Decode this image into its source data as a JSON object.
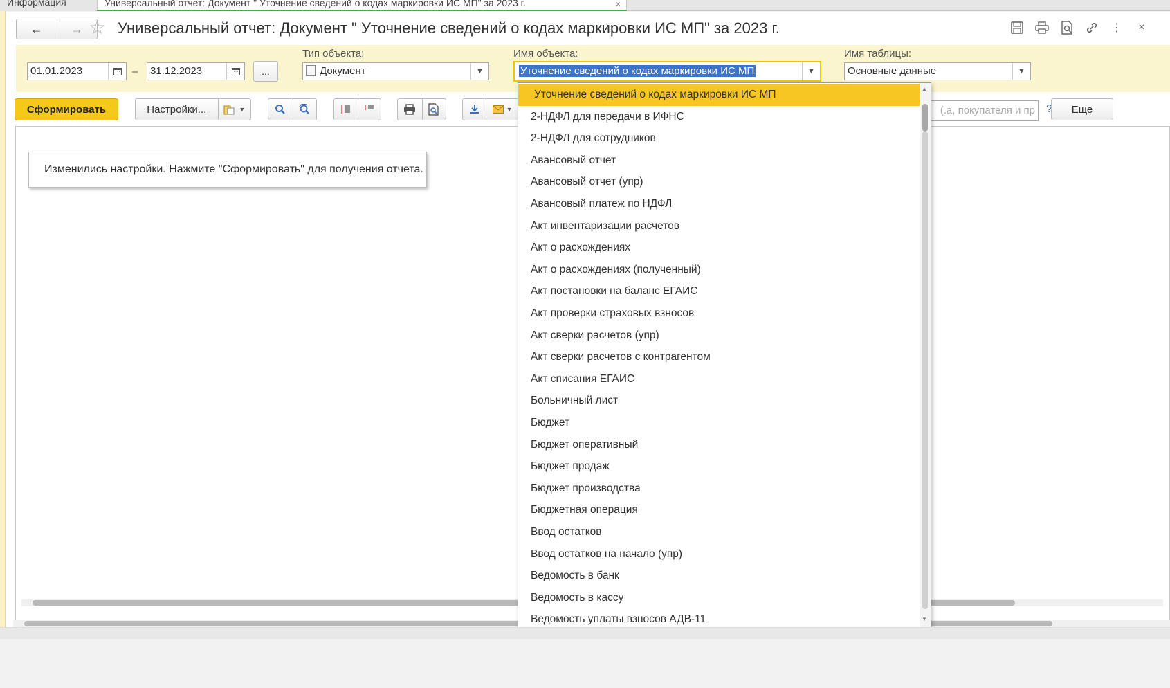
{
  "tabs": [
    {
      "label": "Информация"
    },
    {
      "label": "Универсальный отчет: Документ \" Уточнение сведений о кодах маркировки ИС МП\" за 2023 г."
    }
  ],
  "title": "Универсальный отчет: Документ \" Уточнение сведений о кодах маркировки ИС МП\" за 2023 г.",
  "icons": {
    "back": "←",
    "forward": "→",
    "star": "☆",
    "save": "🖫",
    "print": "⎙",
    "preview": "🔍",
    "link": "🔗",
    "more": "⋮",
    "close": "×"
  },
  "filters": {
    "date_from": "01.01.2023",
    "date_sep": "–",
    "date_to": "31.12.2023",
    "period_btn": "...",
    "object_type_label": "Тип объекта:",
    "object_type_value": "Документ",
    "object_name_label": "Имя объекта:",
    "object_name_value": "Уточнение сведений о кодах маркировки ИС МП",
    "table_name_label": "Имя таблицы:",
    "table_name_value": "Основные данные"
  },
  "toolbar": {
    "generate": "Сформировать",
    "settings": "Настройки...",
    "search_placeholder": "а, покупателя и пр.)",
    "help": "?",
    "more": "Еще"
  },
  "notice": "Изменились настройки. Нажмите \"Сформировать\" для получения отчета.",
  "dropdown": {
    "items": [
      "Уточнение сведений о кодах маркировки ИС МП",
      "2-НДФЛ для передачи в ИФНС",
      "2-НДФЛ для сотрудников",
      "Авансовый отчет",
      "Авансовый отчет (упр)",
      "Авансовый платеж по НДФЛ",
      "Акт инвентаризации расчетов",
      "Акт о расхождениях",
      "Акт о расхождениях (полученный)",
      "Акт постановки на баланс ЕГАИС",
      "Акт проверки страховых взносов",
      "Акт сверки расчетов (упр)",
      "Акт сверки расчетов с контрагентом",
      "Акт списания ЕГАИС",
      "Больничный лист",
      "Бюджет",
      "Бюджет оперативный",
      "Бюджет продаж",
      "Бюджет производства",
      "Бюджетная операция",
      "Ввод остатков",
      "Ввод остатков на начало (упр)",
      "Ведомость в банк",
      "Ведомость в кассу",
      "Ведомость уплаты взносов АДВ-11"
    ]
  },
  "colors": {
    "accent": "#f5c919",
    "panel": "#fbf5cf",
    "selection": "#3d74c9"
  }
}
